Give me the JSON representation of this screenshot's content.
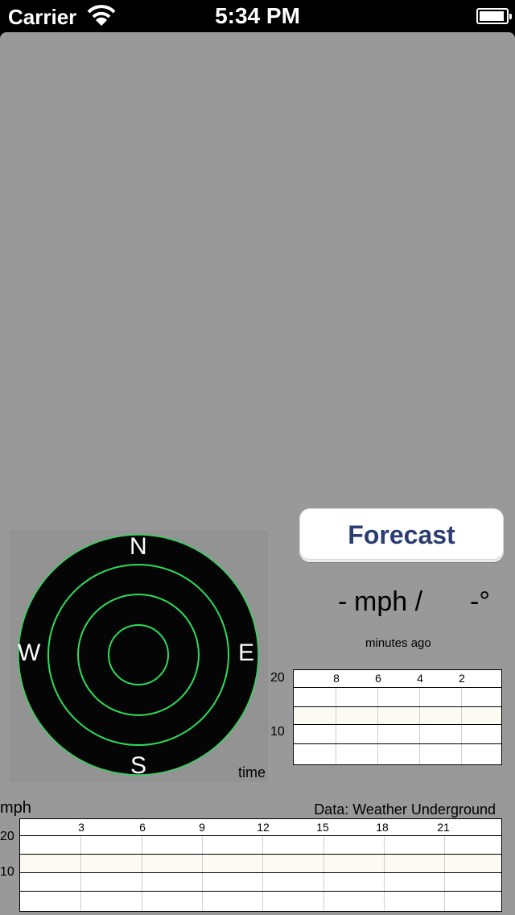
{
  "status_bar": {
    "carrier": "Carrier",
    "time": "5:34 PM",
    "battery_level": 0.95
  },
  "forecast_button": {
    "label": "Forecast"
  },
  "wind": {
    "speed": "-",
    "unit": "mph /",
    "direction": "-°",
    "minutes_ago": "minutes ago"
  },
  "compass": {
    "north": "N",
    "south": "S",
    "east": "E",
    "west": "W",
    "time_label": "time",
    "ring_color": "#2ddc5a"
  },
  "recent_chart": {
    "x_ticks": [
      "8",
      "6",
      "4",
      "2"
    ],
    "y_ticks": [
      "20",
      "10"
    ],
    "ylim": [
      0,
      20
    ]
  },
  "forecast_chart": {
    "unit_label": "mph",
    "source_label": "Data: Weather Underground",
    "x_ticks": [
      "3",
      "6",
      "9",
      "12",
      "15",
      "18",
      "21"
    ],
    "y_ticks": [
      "20",
      "10"
    ],
    "ylim": [
      0,
      20
    ]
  }
}
